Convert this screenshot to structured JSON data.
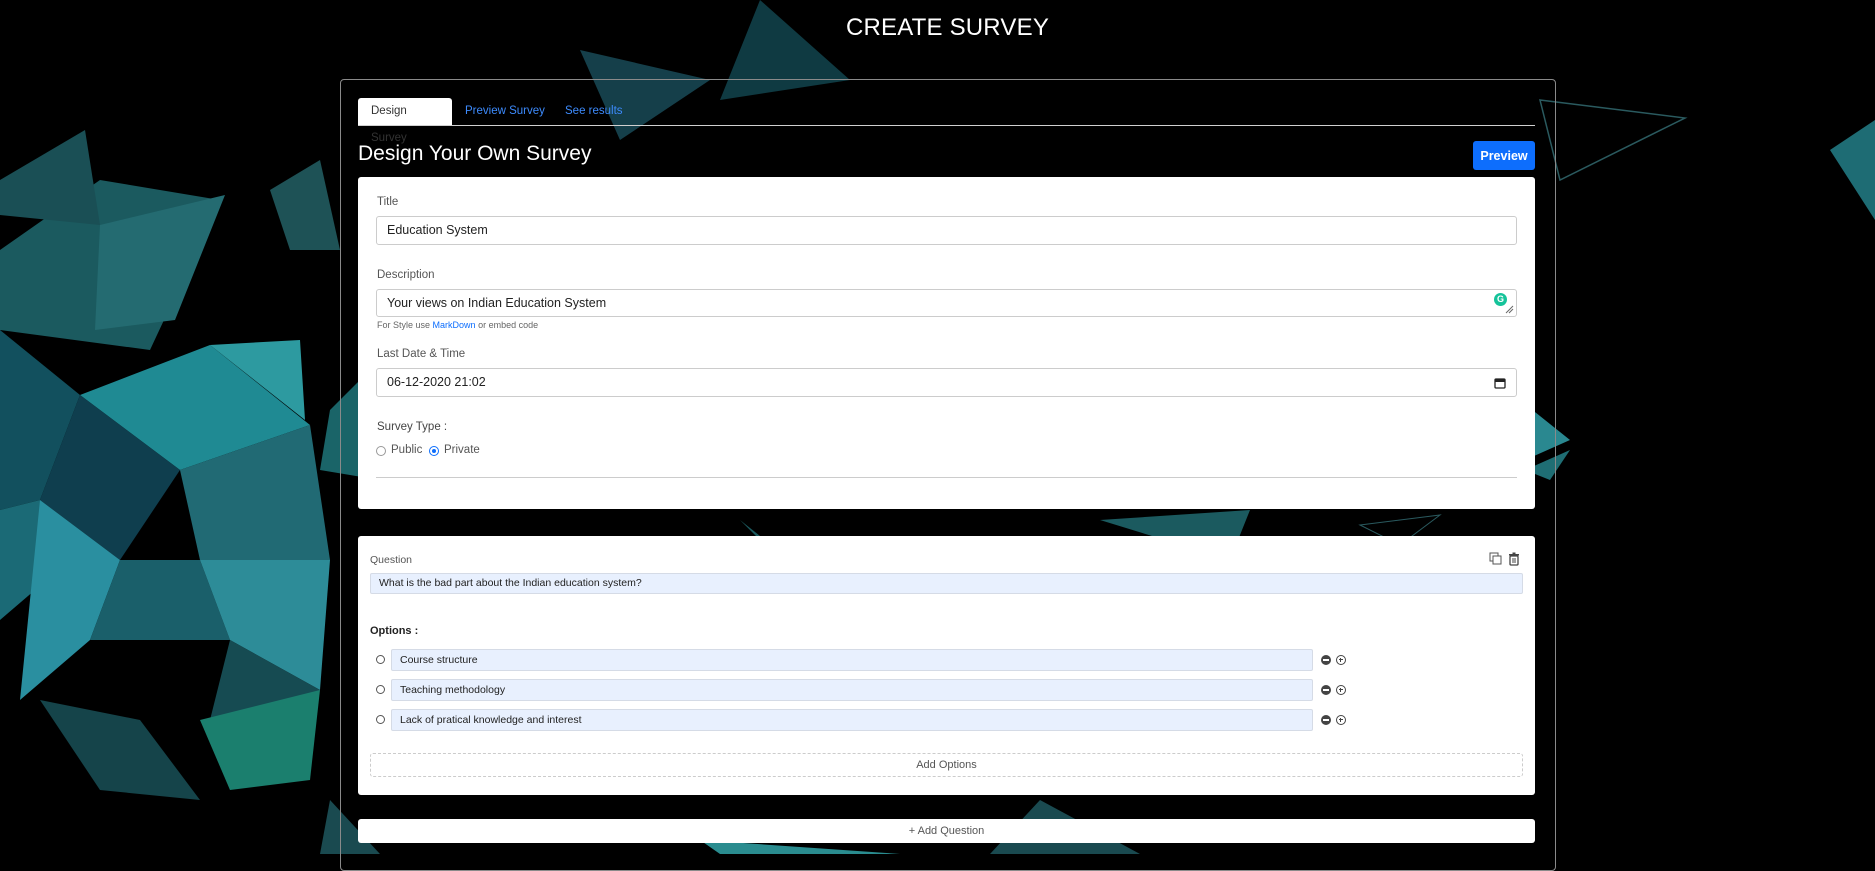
{
  "header": {
    "title": "CREATE SURVEY"
  },
  "tabs": [
    {
      "label": "Design Survey",
      "active": true
    },
    {
      "label": "Preview Survey",
      "active": false
    },
    {
      "label": "See results",
      "active": false
    }
  ],
  "main": {
    "heading": "Design Your Own Survey",
    "preview_button": "Preview"
  },
  "form": {
    "title_label": "Title",
    "title_value": "Education System",
    "description_label": "Description",
    "description_value": "Your views on Indian Education System",
    "hint_prefix": "For Style use",
    "hint_link": "MarkDown",
    "hint_suffix": "or embed code",
    "date_label": "Last Date & Time",
    "date_value": "06-12-2020 21:02",
    "survey_type_label": "Survey Type :",
    "survey_type_options": [
      {
        "label": "Public",
        "selected": false
      },
      {
        "label": "Private",
        "selected": true
      }
    ]
  },
  "question": {
    "label": "Question",
    "value": "What is the bad part about the Indian education system?",
    "options_label": "Options :",
    "options": [
      "Course structure",
      "Teaching methodology",
      "Lack of pratical knowledge and interest"
    ],
    "add_options_label": "Add Options"
  },
  "add_question_label": "+ Add Question",
  "colors": {
    "accent": "#0d6efd",
    "background": "#000000",
    "option_field": "#e8f0fe",
    "shape_teal": "#1f6f78",
    "grammarly": "#15c39a"
  }
}
